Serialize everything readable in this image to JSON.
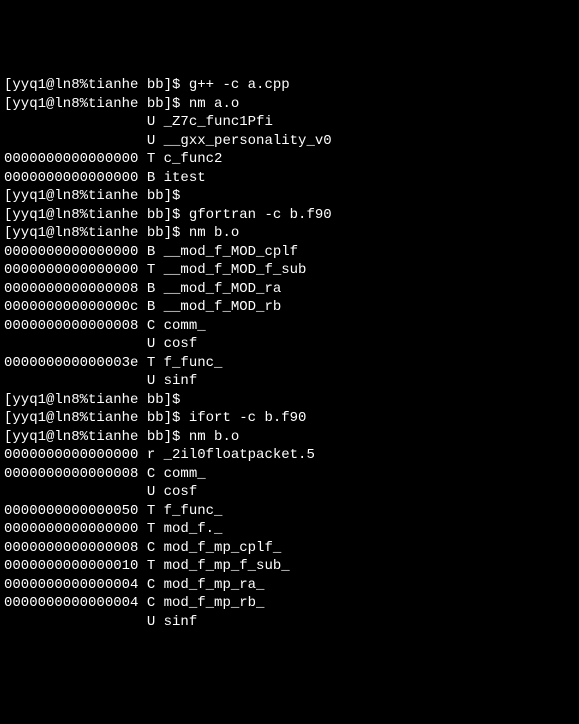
{
  "prompt": "[yyq1@ln8%tianhe bb]$",
  "lines": [
    {
      "prefix": "[yyq1@ln8%tianhe bb]$ ",
      "text": "g++ -c a.cpp"
    },
    {
      "prefix": "[yyq1@ln8%tianhe bb]$ ",
      "text": "nm a.o"
    },
    {
      "prefix": "                 ",
      "text": "U _Z7c_func1Pfi"
    },
    {
      "prefix": "                 ",
      "text": "U __gxx_personality_v0"
    },
    {
      "prefix": "0000000000000000 ",
      "text": "T c_func2"
    },
    {
      "prefix": "0000000000000000 ",
      "text": "B itest"
    },
    {
      "prefix": "[yyq1@ln8%tianhe bb]$ ",
      "text": ""
    },
    {
      "prefix": "[yyq1@ln8%tianhe bb]$ ",
      "text": "gfortran -c b.f90"
    },
    {
      "prefix": "[yyq1@ln8%tianhe bb]$ ",
      "text": "nm b.o"
    },
    {
      "prefix": "0000000000000000 ",
      "text": "B __mod_f_MOD_cplf"
    },
    {
      "prefix": "0000000000000000 ",
      "text": "T __mod_f_MOD_f_sub"
    },
    {
      "prefix": "0000000000000008 ",
      "text": "B __mod_f_MOD_ra"
    },
    {
      "prefix": "000000000000000c ",
      "text": "B __mod_f_MOD_rb"
    },
    {
      "prefix": "0000000000000008 ",
      "text": "C comm_"
    },
    {
      "prefix": "                 ",
      "text": "U cosf"
    },
    {
      "prefix": "000000000000003e ",
      "text": "T f_func_"
    },
    {
      "prefix": "                 ",
      "text": "U sinf"
    },
    {
      "prefix": "[yyq1@ln8%tianhe bb]$ ",
      "text": ""
    },
    {
      "prefix": "[yyq1@ln8%tianhe bb]$ ",
      "text": "ifort -c b.f90"
    },
    {
      "prefix": "[yyq1@ln8%tianhe bb]$ ",
      "text": "nm b.o"
    },
    {
      "prefix": "0000000000000000 ",
      "text": "r _2il0floatpacket.5"
    },
    {
      "prefix": "0000000000000008 ",
      "text": "C comm_"
    },
    {
      "prefix": "                 ",
      "text": "U cosf"
    },
    {
      "prefix": "0000000000000050 ",
      "text": "T f_func_"
    },
    {
      "prefix": "0000000000000000 ",
      "text": "T mod_f._"
    },
    {
      "prefix": "0000000000000008 ",
      "text": "C mod_f_mp_cplf_"
    },
    {
      "prefix": "0000000000000010 ",
      "text": "T mod_f_mp_f_sub_"
    },
    {
      "prefix": "0000000000000004 ",
      "text": "C mod_f_mp_ra_"
    },
    {
      "prefix": "0000000000000004 ",
      "text": "C mod_f_mp_rb_"
    },
    {
      "prefix": "                 ",
      "text": "U sinf"
    }
  ]
}
